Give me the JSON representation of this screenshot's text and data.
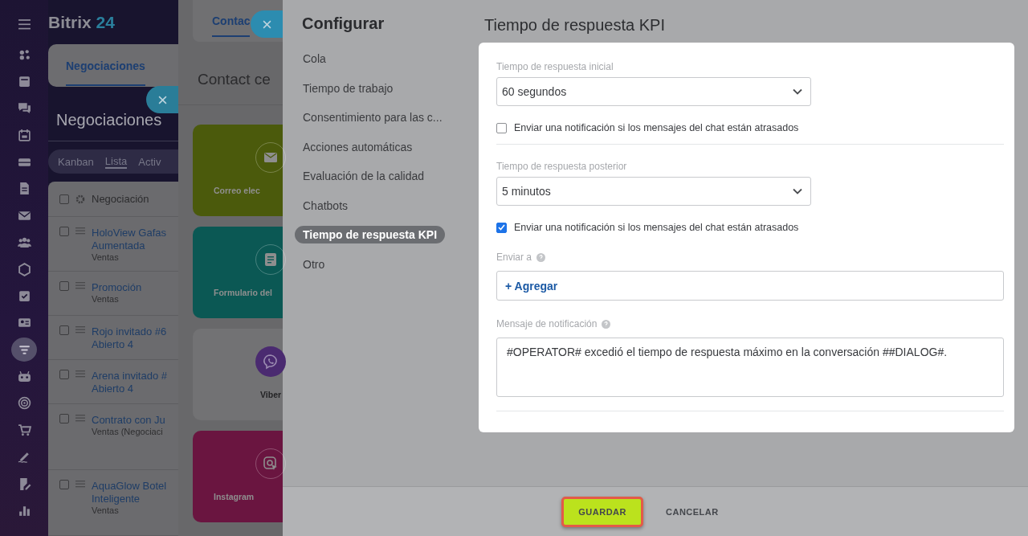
{
  "app": {
    "logo_name": "Bitrix",
    "logo_number": "24"
  },
  "nav_items": [
    {
      "selected": false
    },
    {
      "selected": false
    },
    {
      "selected": false
    },
    {
      "selected": false
    },
    {
      "selected": false
    },
    {
      "selected": false
    },
    {
      "selected": false
    },
    {
      "selected": false
    },
    {
      "selected": false
    },
    {
      "selected": false
    },
    {
      "selected": false
    },
    {
      "selected": true
    },
    {
      "selected": false
    },
    {
      "selected": false
    },
    {
      "selected": false
    },
    {
      "selected": false
    },
    {
      "selected": false
    },
    {
      "selected": false
    }
  ],
  "deals": {
    "tab": {
      "label": "Negociaciones",
      "selected": true
    },
    "title": "Negociaciones",
    "views": [
      {
        "label": "Kanban",
        "selected": false
      },
      {
        "label": "Lista",
        "selected": true
      },
      {
        "label": "Activ",
        "selected": false
      }
    ],
    "column": "Negociación",
    "all_checked": false,
    "rows": [
      {
        "title_lines": [
          "HoloView Gafas",
          "Aumentada"
        ],
        "subtitle": "Ventas",
        "checked": false
      },
      {
        "title_lines": [
          "Promoción"
        ],
        "subtitle": "Ventas",
        "checked": false
      },
      {
        "title_lines": [
          "Rojo invitado #6",
          "Abierto 4"
        ],
        "checked": false
      },
      {
        "title_lines": [
          "Arena invitado #",
          "Abierto 4"
        ],
        "checked": false
      },
      {
        "title_lines": [
          "Contrato con Ju"
        ],
        "subtitle": "Ventas (Negociaci",
        "checked": false
      },
      {
        "title_lines": [
          "AquaGlow Botel",
          "Inteligente"
        ],
        "subtitle": "Ventas",
        "checked": false
      }
    ]
  },
  "contact_center": {
    "tab": {
      "label": "Contac",
      "selected": true
    },
    "title": "Contact ce",
    "cards": [
      {
        "label": "Correo elec",
        "kind": "mail",
        "color": "#4b5a0c"
      },
      {
        "label": "Formulario del",
        "kind": "form",
        "color": "#0b5854"
      },
      {
        "label": "Viber",
        "kind": "viber",
        "color": "#727274"
      },
      {
        "label": "Instagram",
        "kind": "instagram",
        "color": "#6a1540"
      }
    ]
  },
  "settings": {
    "title": "Configurar",
    "menu": [
      {
        "label": "Cola",
        "selected": false
      },
      {
        "label": "Tiempo de trabajo",
        "selected": false
      },
      {
        "label": "Consentimiento para las c...",
        "selected": false
      },
      {
        "label": "Acciones automáticas",
        "selected": false
      },
      {
        "label": "Evaluación de la calidad",
        "selected": false
      },
      {
        "label": "Chatbots",
        "selected": false
      },
      {
        "label": "Tiempo de respuesta KPI",
        "selected": true
      },
      {
        "label": "Otro",
        "selected": false
      }
    ],
    "page_title": "Tiempo de respuesta KPI",
    "initial": {
      "label": "Tiempo de respuesta inicial",
      "value": "60 segundos",
      "notify": {
        "label": "Enviar una notificación si los mensajes del chat están atrasados",
        "checked": false
      }
    },
    "subsequent": {
      "label": "Tiempo de respuesta posterior",
      "value": "5 minutos",
      "notify": {
        "label": "Enviar una notificación si los mensajes del chat están atrasados",
        "checked": true
      }
    },
    "send_to": {
      "label": "Enviar a",
      "add": "+ Agregar"
    },
    "message": {
      "label": "Mensaje de notificación",
      "value": "#OPERATOR# excedió el tiempo de respuesta máximo en la conversación ##DIALOG#."
    }
  },
  "footer": {
    "buttons": [
      {
        "label": "GUARDAR",
        "kind": "primary",
        "highlighted": true
      },
      {
        "label": "CANCELAR",
        "kind": "link",
        "highlighted": false
      }
    ]
  }
}
